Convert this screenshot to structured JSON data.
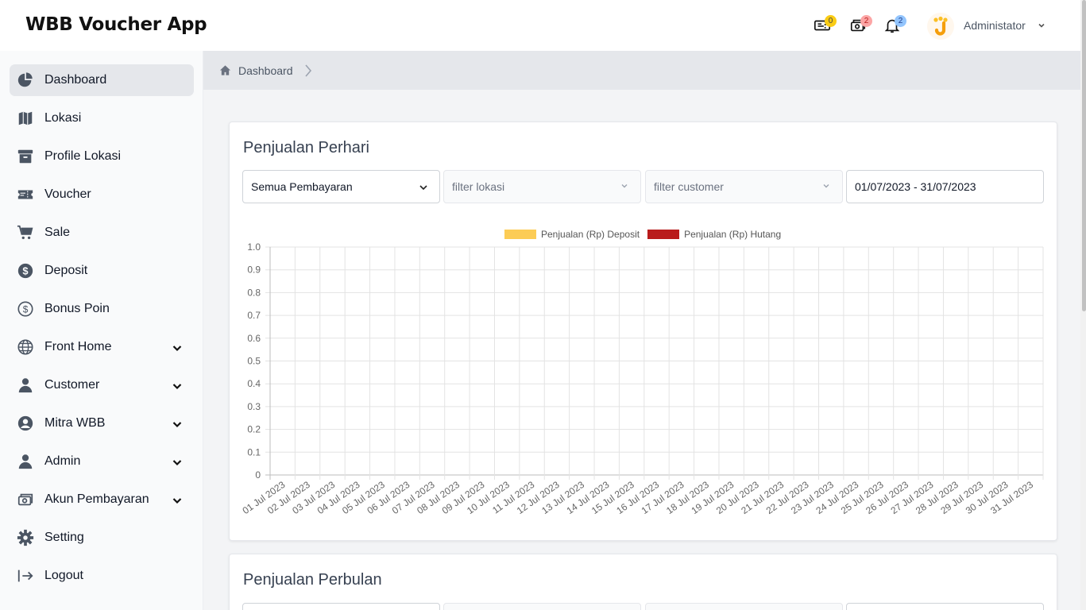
{
  "app": {
    "title": "WBB Voucher App"
  },
  "topbar": {
    "voucher_badge": "0",
    "payment_badge": "2",
    "notification_badge": "2",
    "user_name": "Administator"
  },
  "sidebar": {
    "items": [
      {
        "label": "Dashboard",
        "icon": "pie-chart-icon",
        "active": true
      },
      {
        "label": "Lokasi",
        "icon": "map-icon"
      },
      {
        "label": "Profile Lokasi",
        "icon": "archive-icon"
      },
      {
        "label": "Voucher",
        "icon": "ticket-icon"
      },
      {
        "label": "Sale",
        "icon": "cart-icon"
      },
      {
        "label": "Deposit",
        "icon": "dollar-circle-icon"
      },
      {
        "label": "Bonus Poin",
        "icon": "dollar-outline-icon"
      },
      {
        "label": "Front Home",
        "icon": "globe-icon",
        "expandable": true
      },
      {
        "label": "Customer",
        "icon": "user-icon",
        "expandable": true
      },
      {
        "label": "Mitra WBB",
        "icon": "user-circle-icon",
        "expandable": true
      },
      {
        "label": "Admin",
        "icon": "user-icon",
        "expandable": true
      },
      {
        "label": "Akun Pembayaran",
        "icon": "cash-icon",
        "expandable": true
      },
      {
        "label": "Setting",
        "icon": "gear-icon"
      },
      {
        "label": "Logout",
        "icon": "logout-icon"
      }
    ]
  },
  "breadcrumb": {
    "current": "Dashboard"
  },
  "daily": {
    "title": "Penjualan Perhari",
    "payment_select": "Semua Pembayaran",
    "location_placeholder": "filter lokasi",
    "customer_placeholder": "filter customer",
    "date_range": "01/07/2023 - 31/07/2023"
  },
  "monthly": {
    "title": "Penjualan Perbulan"
  },
  "colors": {
    "deposit": "#fccc55",
    "hutang": "#b91c1c"
  },
  "chart_data": {
    "type": "bar",
    "categories": [
      "01 Jul 2023",
      "02 Jul 2023",
      "03 Jul 2023",
      "04 Jul 2023",
      "05 Jul 2023",
      "06 Jul 2023",
      "07 Jul 2023",
      "08 Jul 2023",
      "09 Jul 2023",
      "10 Jul 2023",
      "11 Jul 2023",
      "12 Jul 2023",
      "13 Jul 2023",
      "14 Jul 2023",
      "15 Jul 2023",
      "16 Jul 2023",
      "17 Jul 2023",
      "18 Jul 2023",
      "19 Jul 2023",
      "20 Jul 2023",
      "21 Jul 2023",
      "22 Jul 2023",
      "23 Jul 2023",
      "24 Jul 2023",
      "25 Jul 2023",
      "26 Jul 2023",
      "27 Jul 2023",
      "28 Jul 2023",
      "29 Jul 2023",
      "30 Jul 2023",
      "31 Jul 2023"
    ],
    "series": [
      {
        "name": "Penjualan (Rp) Deposit",
        "values": [
          0,
          0,
          0,
          0,
          0,
          0,
          0,
          0,
          0,
          0,
          0,
          0,
          0,
          0,
          0,
          0,
          0,
          0,
          0,
          0,
          0,
          0,
          0,
          0,
          0,
          0,
          0,
          0,
          0,
          0,
          0
        ]
      },
      {
        "name": "Penjualan (Rp) Hutang",
        "values": [
          0,
          0,
          0,
          0,
          0,
          0,
          0,
          0,
          0,
          0,
          0,
          0,
          0,
          0,
          0,
          0,
          0,
          0,
          0,
          0,
          0,
          0,
          0,
          0,
          0,
          0,
          0,
          0,
          0,
          0,
          0
        ]
      }
    ],
    "ylim": [
      0,
      1
    ],
    "yticks": [
      "0",
      "0.1",
      "0.2",
      "0.3",
      "0.4",
      "0.5",
      "0.6",
      "0.7",
      "0.8",
      "0.9",
      "1.0"
    ],
    "grid": true,
    "legend": "top-center"
  }
}
